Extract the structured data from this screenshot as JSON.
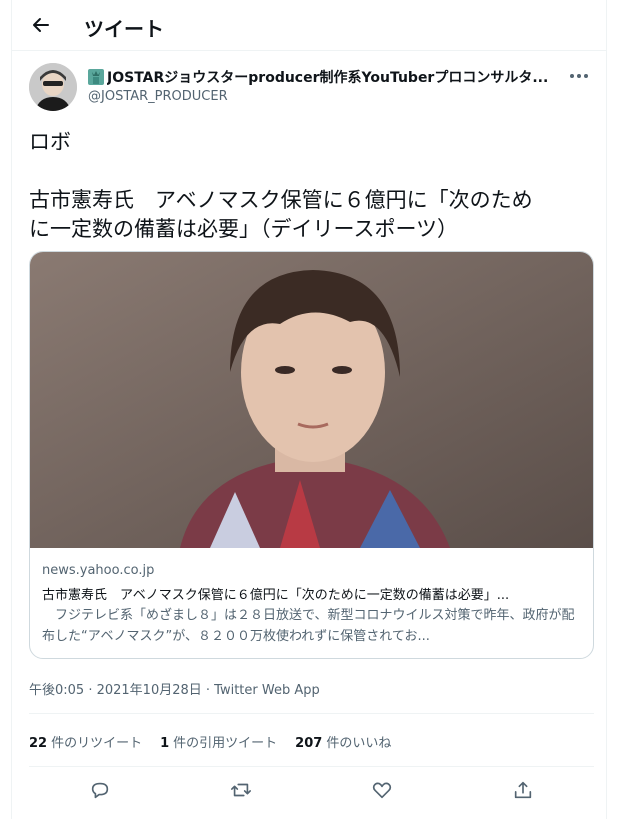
{
  "header": {
    "title": "ツイート"
  },
  "author": {
    "display_name": "JOSTARジョウスターproducer制作系YouTuberプロコンサルタ...",
    "handle": "@JOSTAR_PRODUCER"
  },
  "tweet": {
    "text": "ロボ\n\n古市憲寿氏　アベノマスク保管に６億円に「次のため\nに一定数の備蓄は必要」（デイリースポーツ）"
  },
  "card": {
    "domain": "news.yahoo.co.jp",
    "title": "古市憲寿氏　アベノマスク保管に６億円に「次のために一定数の備蓄は必要」...",
    "description": "　フジテレビ系「めざまし８」は２８日放送で、新型コロナウイルス対策で昨年、政府が配布した“アベノマスク”が、８２００万枚使われずに保管されてお..."
  },
  "meta": {
    "timestamp": "午後0:05 · 2021年10月28日 · Twitter Web App"
  },
  "stats": {
    "retweets_count": "22",
    "retweets_label": "件のリツイート",
    "quotes_count": "1",
    "quotes_label": "件の引用ツイート",
    "likes_count": "207",
    "likes_label": "件のいいね"
  },
  "icons": {
    "back": "arrow-left-icon",
    "more": "more-horizontal-icon",
    "reply": "reply-icon",
    "retweet": "retweet-icon",
    "like": "heart-icon",
    "share": "share-icon"
  },
  "colors": {
    "text": "#0f1419",
    "secondary": "#536471",
    "border": "#cfd9de"
  }
}
